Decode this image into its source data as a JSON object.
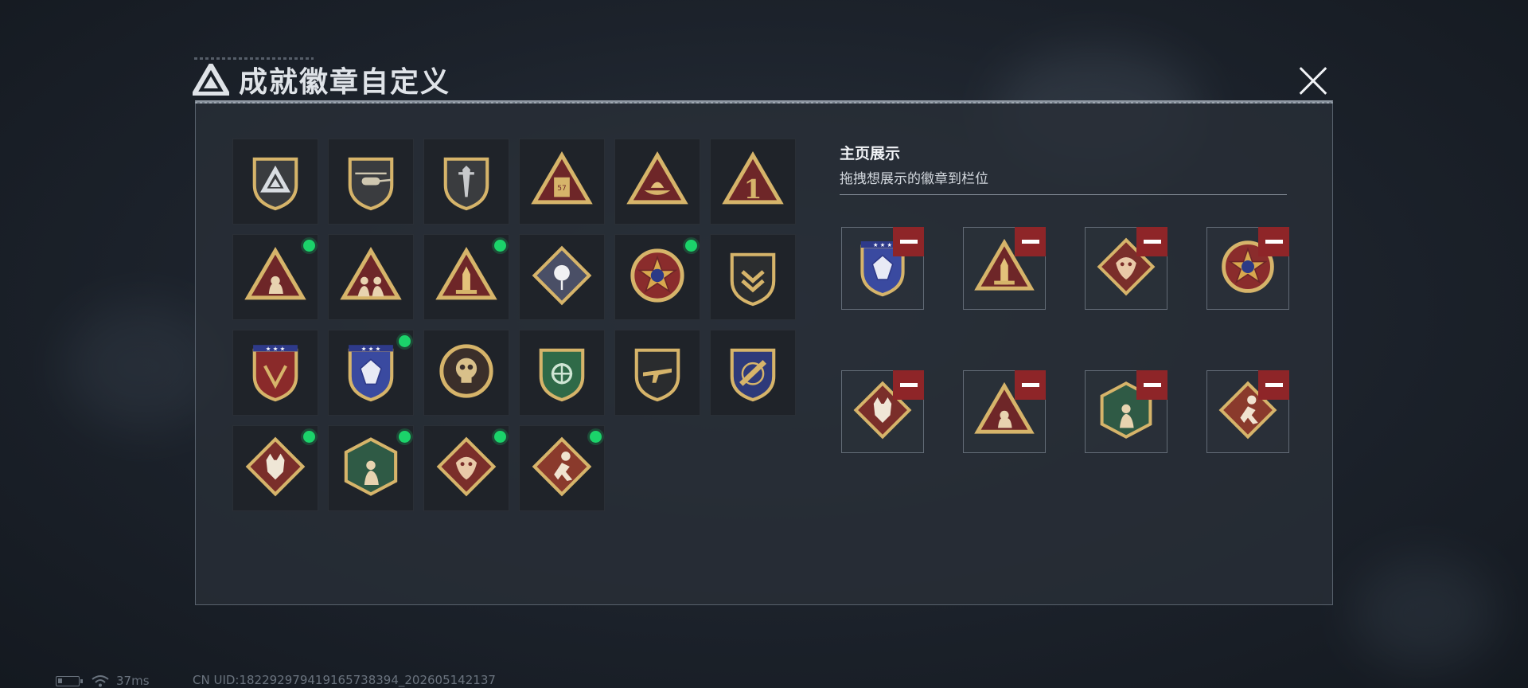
{
  "window": {
    "title": "成就徽章自定义"
  },
  "showcase": {
    "title": "主页展示",
    "subtitle": "拖拽想展示的徽章到栏位"
  },
  "status": {
    "ping": "37ms",
    "uid": "CN UID:182292979419165738394_202605142137"
  },
  "colors": {
    "new_dot": "#1bd36a",
    "remove": "#8e2528",
    "gold": "#d6b46a",
    "maroon": "#6e2628"
  },
  "badges": [
    {
      "icon": "shield-triangle-icon",
      "new": false
    },
    {
      "icon": "helicopter-shield-icon",
      "new": false
    },
    {
      "icon": "dagger-shield-icon",
      "new": false
    },
    {
      "icon": "ammo-can-triangle-icon",
      "new": false
    },
    {
      "icon": "boat-triangle-icon",
      "new": false
    },
    {
      "icon": "number-one-triangle-icon",
      "new": false
    },
    {
      "icon": "soldier-triangle-icon",
      "new": true
    },
    {
      "icon": "squad-triangle-icon",
      "new": false
    },
    {
      "icon": "missile-triangle-icon",
      "new": true
    },
    {
      "icon": "rose-diamond-icon",
      "new": false
    },
    {
      "icon": "star-emblem-icon",
      "new": true
    },
    {
      "icon": "chevron-shield-icon",
      "new": false
    },
    {
      "icon": "stars-crest-icon",
      "new": false
    },
    {
      "icon": "gem-crest-icon",
      "new": true
    },
    {
      "icon": "skull-medallion-icon",
      "new": false
    },
    {
      "icon": "crosshair-wreath-icon",
      "new": false
    },
    {
      "icon": "rifle-shield-icon",
      "new": false
    },
    {
      "icon": "rocket-crest-icon",
      "new": false
    },
    {
      "icon": "wolf-diamond-icon",
      "new": true
    },
    {
      "icon": "fighter-hexagon-icon",
      "new": true
    },
    {
      "icon": "dragon-diamond-icon",
      "new": true
    },
    {
      "icon": "runner-diamond-icon",
      "new": true
    }
  ],
  "slots": [
    {
      "icon": "gem-crest-icon"
    },
    {
      "icon": "missile-triangle-icon"
    },
    {
      "icon": "dragon-diamond-icon"
    },
    {
      "icon": "star-emblem-icon"
    },
    {
      "icon": "wolf-diamond-icon"
    },
    {
      "icon": "soldier-triangle-icon"
    },
    {
      "icon": "fighter-hexagon-icon"
    },
    {
      "icon": "runner-diamond-icon"
    }
  ]
}
